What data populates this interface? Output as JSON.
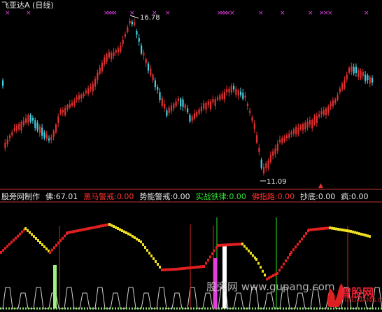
{
  "header": {
    "title": "飞亚达A (日线)"
  },
  "price_chart": {
    "high_label": "16.78",
    "low_label": "11.09",
    "candle_up_color": "#e03030",
    "candle_down_color": "#40d0e0",
    "signal_marker_color": "#e040e0"
  },
  "indicator_header": {
    "name": "股旁网制作",
    "items": [
      {
        "label": "佛:",
        "value": "67.01",
        "label_color": "#e8e8e8",
        "value_color": "#e8e8e8"
      },
      {
        "label": "黑马警戒:",
        "value": "0.00",
        "label_color": "#ff3030",
        "value_color": "#ff3030"
      },
      {
        "label": "势能警戒:",
        "value": "0.00",
        "label_color": "#e8e8e8",
        "value_color": "#e8e8e8"
      },
      {
        "label": "实战铁律:",
        "value": "0.00",
        "label_color": "#30e030",
        "value_color": "#30e030"
      },
      {
        "label": "佛指路:",
        "value": "0.00",
        "label_color": "#ff3030",
        "value_color": "#ff3030"
      },
      {
        "label": "抄底:",
        "value": "0.00",
        "label_color": "#e8e8e8",
        "value_color": "#e8e8e8"
      },
      {
        "label": "疯:",
        "value": "0.00",
        "label_color": "#e8e8e8",
        "value_color": "#e8e8e8"
      }
    ]
  },
  "watermark": {
    "text": "股旁网 www.gupang.com"
  },
  "logo": {
    "text": "智股网",
    "url": "ZHIGUWANG.CN"
  },
  "colors": {
    "background": "#000000",
    "separator": "#c03030",
    "line_up": "#e02020",
    "line_down": "#f0e020",
    "signal_bar": "#e02020"
  }
}
